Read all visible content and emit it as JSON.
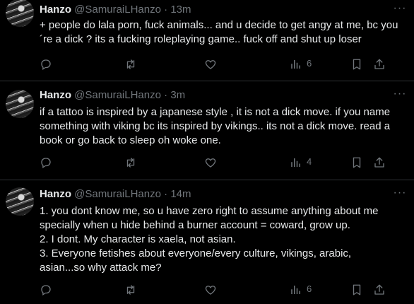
{
  "tweets": [
    {
      "name": "Hanzo",
      "handle": "@SamuraiLHanzo",
      "separator": "·",
      "time": "13m",
      "lines": [
        "+ people do lala porn, fuck animals... and u decide to get angy at me, bc you",
        "´re  a dick ? its a fucking roleplaying game.. fuck off and shut up loser"
      ],
      "views": "6"
    },
    {
      "name": "Hanzo",
      "handle": "@SamuraiLHanzo",
      "separator": "·",
      "time": "3m",
      "lines": [
        "if a tattoo is inspired by a japanese style , it is not a dick move. if you name",
        "something with viking bc its inspired by vikings.. its not  a dick move. read a",
        "book or go back to sleep oh woke one."
      ],
      "views": "4"
    },
    {
      "name": "Hanzo",
      "handle": "@SamuraiLHanzo",
      "separator": "·",
      "time": "14m",
      "lines": [
        "1. you dont know me, so u have zero right to assume anything about me",
        "specially when u hide behind a burner account = coward, grow up.",
        "2. I dont. My character is xaela, not asian.",
        "3. Everyone fetishes about everyone/every culture, vikings, arabic,",
        "asian...so why attack me?"
      ],
      "views": "6"
    }
  ],
  "icons": {
    "more": "more-icon",
    "reply": "reply-icon",
    "retweet": "retweet-icon",
    "like": "heart-icon",
    "views": "views-icon",
    "bookmark": "bookmark-icon",
    "share": "share-icon"
  },
  "colors": {
    "background": "#000000",
    "text": "#e7e9ea",
    "muted": "#71767b",
    "divider": "#2f3336"
  }
}
